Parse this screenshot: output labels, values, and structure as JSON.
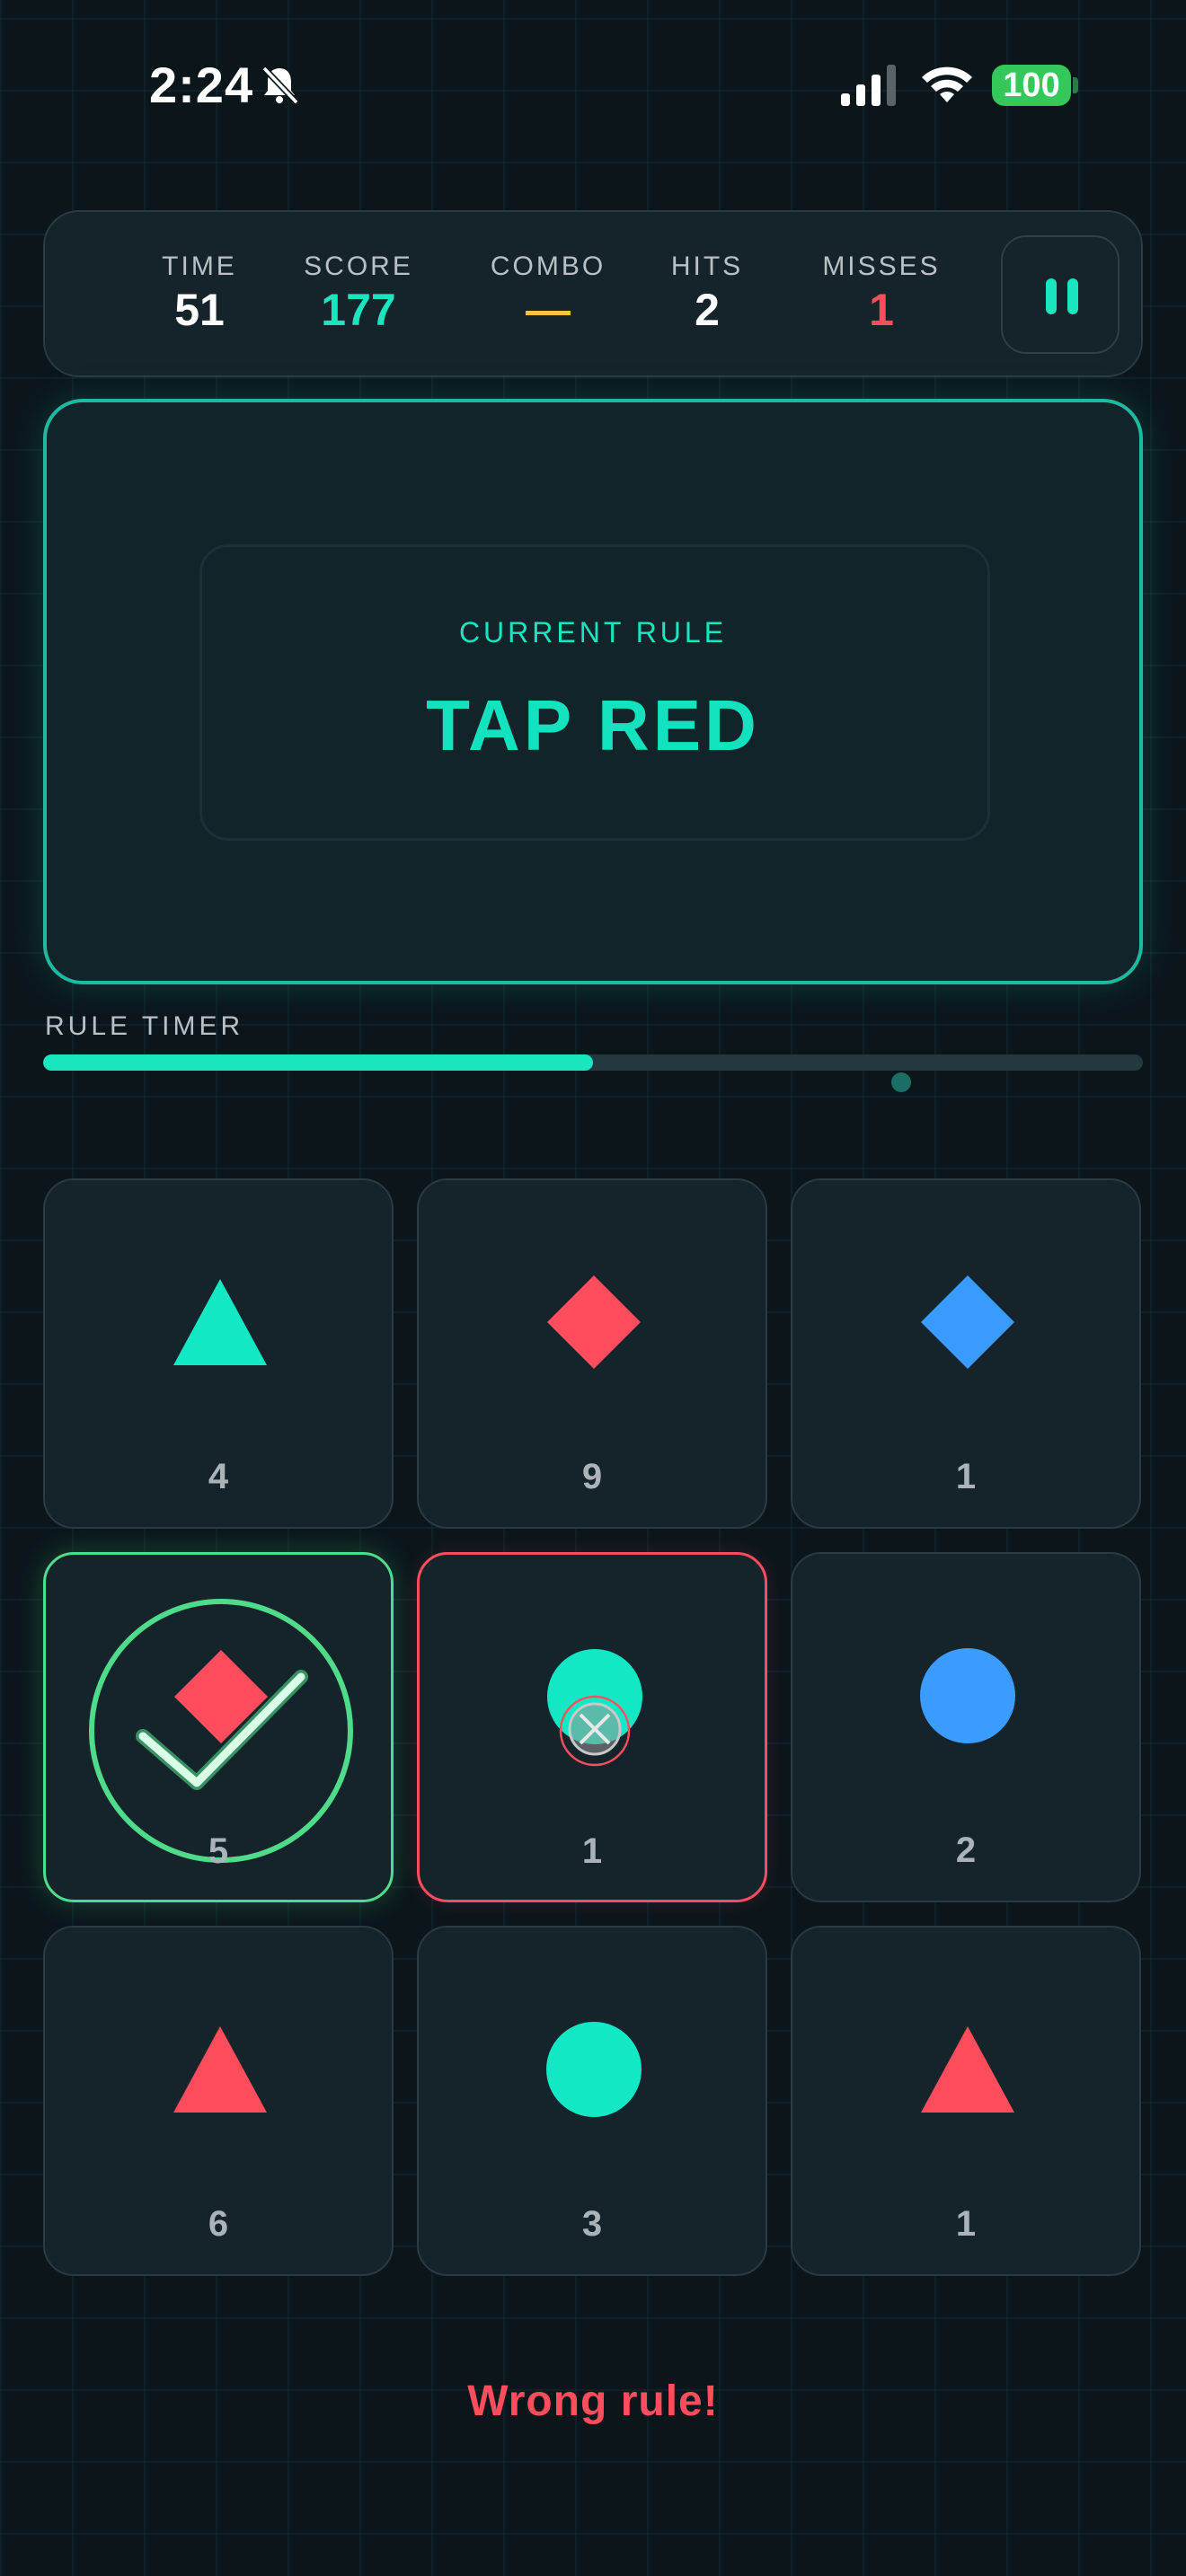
{
  "status_bar": {
    "time": "2:24",
    "battery": "100",
    "icons": [
      "bell-slash-icon",
      "cellular-signal-icon",
      "wifi-icon",
      "battery-icon"
    ]
  },
  "hud": {
    "stats": [
      {
        "label": "TIME",
        "value": "51",
        "color": "#ffffff"
      },
      {
        "label": "SCORE",
        "value": "177",
        "color": "#19e6bf"
      },
      {
        "label": "COMBO",
        "value": "—",
        "color": "#f5c542"
      },
      {
        "label": "HITS",
        "value": "2",
        "color": "#ffffff"
      },
      {
        "label": "MISSES",
        "value": "1",
        "color": "#ff4d5e"
      }
    ],
    "pause_icon": "pause-icon"
  },
  "rule": {
    "caption": "CURRENT RULE",
    "text": "TAP RED"
  },
  "timer": {
    "label": "RULE TIMER",
    "progress": 0.5
  },
  "grid": {
    "cells": [
      {
        "shape": "triangle",
        "color": "#12e8c4",
        "number": "4",
        "state": "normal"
      },
      {
        "shape": "diamond",
        "color": "#ff4d5e",
        "number": "9",
        "state": "normal"
      },
      {
        "shape": "diamond",
        "color": "#3b9cff",
        "number": "1",
        "state": "normal"
      },
      {
        "shape": "diamond",
        "color": "#ff4d5e",
        "number": "5",
        "state": "correct"
      },
      {
        "shape": "circle",
        "color": "#12e8c4",
        "number": "1",
        "state": "wrong"
      },
      {
        "shape": "circle",
        "color": "#3b9cff",
        "number": "2",
        "state": "normal"
      },
      {
        "shape": "triangle",
        "color": "#ff4d5e",
        "number": "6",
        "state": "normal"
      },
      {
        "shape": "circle",
        "color": "#12e8c4",
        "number": "3",
        "state": "normal"
      },
      {
        "shape": "triangle",
        "color": "#ff4d5e",
        "number": "1",
        "state": "normal"
      }
    ]
  },
  "feedback": "Wrong rule!",
  "colors": {
    "accent": "#19e6bf",
    "danger": "#ff4d5e",
    "success": "#4fdc8a",
    "combo": "#f5c542"
  }
}
